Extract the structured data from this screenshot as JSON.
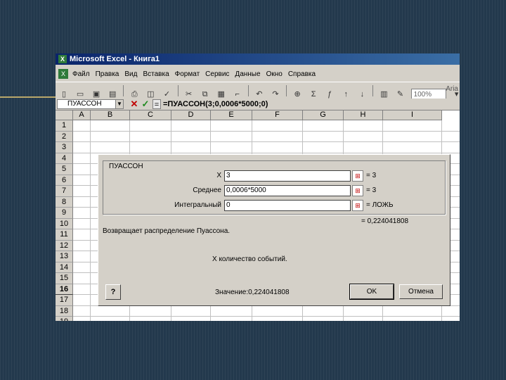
{
  "window": {
    "title": "Microsoft Excel - Книга1",
    "app_icon": "excel-icon"
  },
  "menu": [
    "Файл",
    "Правка",
    "Вид",
    "Вставка",
    "Формат",
    "Сервис",
    "Данные",
    "Окно",
    "Справка"
  ],
  "toolbar": {
    "zoom": "100%",
    "font": "Aria"
  },
  "formula_bar": {
    "name_box": "ПУАССОН",
    "formula": "=ПУАССОН(3;0,0006*5000;0)"
  },
  "grid": {
    "columns": [
      "A",
      "B",
      "C",
      "D",
      "E",
      "F",
      "G",
      "H",
      "I"
    ],
    "rows": [
      "1",
      "2",
      "3",
      "4",
      "5",
      "6",
      "7",
      "8",
      "9",
      "10",
      "11",
      "12",
      "13",
      "14",
      "15",
      "16",
      "17",
      "18",
      "19"
    ],
    "active_row": "16"
  },
  "dialog": {
    "group_title": "ПУАССОН",
    "args": [
      {
        "label": "X",
        "value": "3",
        "result": "= 3"
      },
      {
        "label": "Среднее",
        "value": "0,0006*5000",
        "result": "= 3"
      },
      {
        "label": "Интегральный",
        "value": "0",
        "result": "= ЛОЖЬ"
      }
    ],
    "total_result": "= 0,224041808",
    "description": "Возвращает распределение Пуассона.",
    "arg_help": "X  количество событий.",
    "value_text": "Значение:0,224041808",
    "help_label": "?",
    "ok_label": "OK",
    "cancel_label": "Отмена"
  }
}
